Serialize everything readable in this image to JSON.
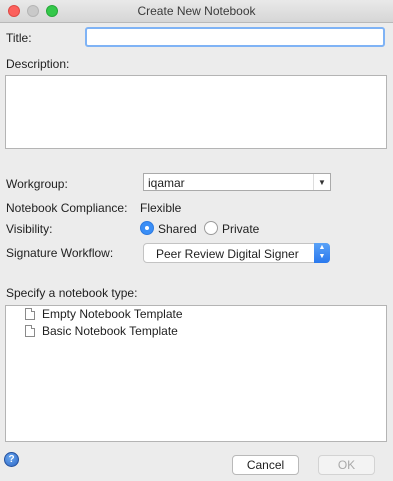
{
  "window": {
    "title": "Create New Notebook"
  },
  "form": {
    "title_label": "Title:",
    "title_value": "",
    "description_label": "Description:",
    "description_value": "",
    "workgroup_label": "Workgroup:",
    "workgroup_value": "iqamar",
    "compliance_label": "Notebook Compliance:",
    "compliance_value": "Flexible",
    "visibility_label": "Visibility:",
    "visibility_options": [
      {
        "label": "Shared",
        "selected": true
      },
      {
        "label": "Private",
        "selected": false
      }
    ],
    "signature_label": "Signature Workflow:",
    "signature_value": "Peer Review Digital Signer",
    "type_label": "Specify a notebook type:",
    "templates": [
      {
        "label": "Empty Notebook Template",
        "icon": "document-icon"
      },
      {
        "label": "Basic Notebook Template",
        "icon": "document-icon"
      }
    ]
  },
  "buttons": {
    "cancel": "Cancel",
    "ok": "OK",
    "help_glyph": "?"
  },
  "colors": {
    "accent": "#3a8ef6",
    "focus_ring": "#7fb3f5",
    "close": "#fc605c",
    "maximize": "#34c84a"
  }
}
